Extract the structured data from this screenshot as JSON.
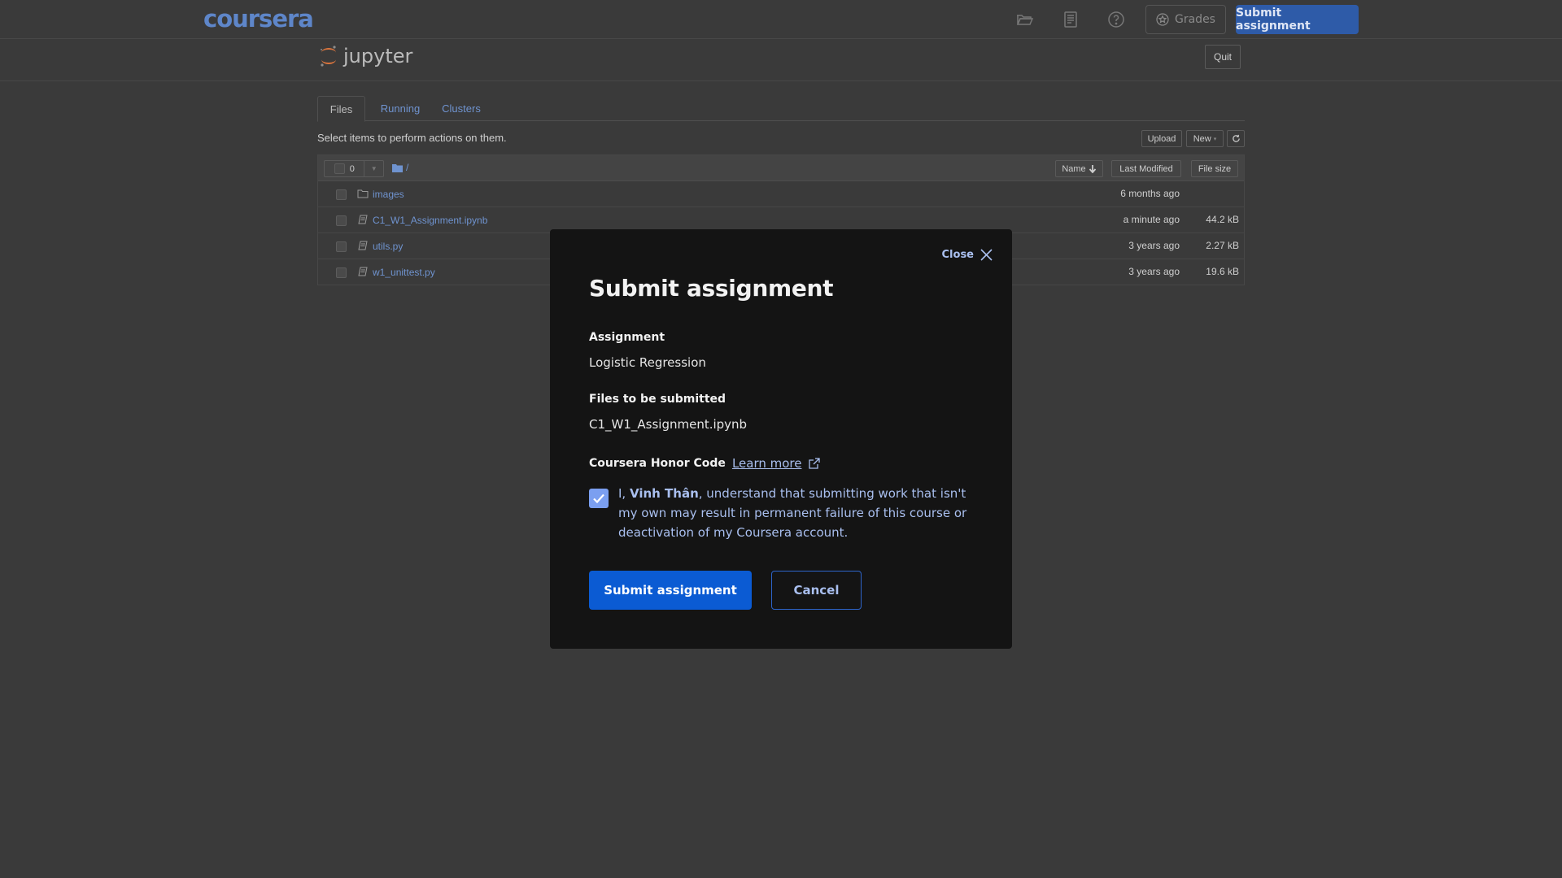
{
  "topbar": {
    "logo": "coursera",
    "icons": [
      "folder-open-icon",
      "notebook-icon",
      "help-icon"
    ],
    "grades_label": "Grades",
    "submit_label": "Submit assignment"
  },
  "jupyter": {
    "logo_text": "jupyter",
    "quit_label": "Quit",
    "tabs": [
      {
        "label": "Files",
        "active": true
      },
      {
        "label": "Running",
        "active": false
      },
      {
        "label": "Clusters",
        "active": false
      }
    ],
    "instructions": "Select items to perform actions on them.",
    "upload_label": "Upload",
    "new_label": "New",
    "selected_count": "0",
    "breadcrumb": "/",
    "columns": {
      "name": "Name",
      "last_modified": "Last Modified",
      "file_size": "File size"
    },
    "files": [
      {
        "name": "images",
        "type": "folder",
        "modified": "6 months ago",
        "size": ""
      },
      {
        "name": "C1_W1_Assignment.ipynb",
        "type": "notebook",
        "modified": "a minute ago",
        "size": "44.2 kB"
      },
      {
        "name": "utils.py",
        "type": "file",
        "modified": "3 years ago",
        "size": "2.27 kB"
      },
      {
        "name": "w1_unittest.py",
        "type": "file",
        "modified": "3 years ago",
        "size": "19.6 kB"
      }
    ]
  },
  "modal": {
    "close_label": "Close",
    "title": "Submit assignment",
    "assignment_label": "Assignment",
    "assignment_value": "Logistic Regression",
    "files_label": "Files to be submitted",
    "files_value": "C1_W1_Assignment.ipynb",
    "honor_label": "Coursera Honor Code",
    "learn_more": "Learn more",
    "honor_prefix": "I, ",
    "honor_name": "Vinh Thân",
    "honor_suffix": ", understand that submitting work that isn't my own may result in permanent failure of this course or deactivation of my Coursera account.",
    "honor_checked": true,
    "submit_label": "Submit assignment",
    "cancel_label": "Cancel"
  },
  "colors": {
    "page_bg": "#3a3a3a",
    "link_blue": "#6f93cf",
    "modal_bg": "#141414",
    "primary": "#0b5bd3",
    "accent_light": "#a9bfef"
  }
}
